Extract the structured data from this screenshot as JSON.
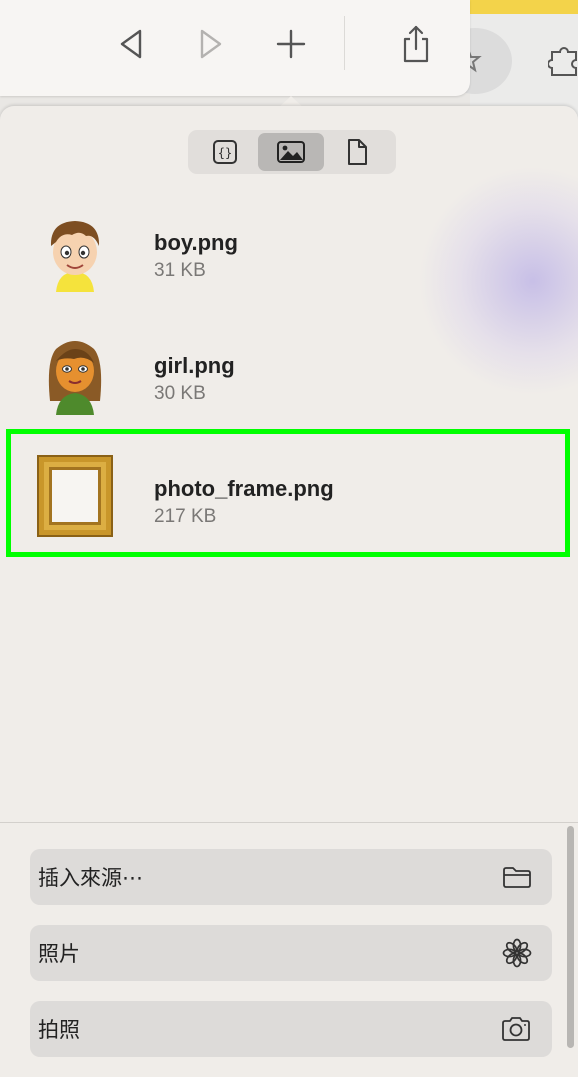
{
  "toolbar": {
    "back_icon": "back-triangle-icon",
    "forward_icon": "forward-triangle-icon",
    "new_tab_icon": "plus-icon",
    "share_icon": "share-icon"
  },
  "segments": [
    {
      "name": "json-icon",
      "active": false
    },
    {
      "name": "image-icon",
      "active": true
    },
    {
      "name": "document-icon",
      "active": false
    }
  ],
  "files": [
    {
      "name": "boy.png",
      "size": "31 KB"
    },
    {
      "name": "girl.png",
      "size": "30 KB"
    },
    {
      "name": "photo_frame.png",
      "size": "217 KB"
    }
  ],
  "actions": [
    {
      "label": "插入來源⋯",
      "icon": "folder-icon"
    },
    {
      "label": "照片",
      "icon": "flower-icon"
    },
    {
      "label": "拍照",
      "icon": "camera-icon"
    }
  ],
  "colors": {
    "highlight": "#00ff00",
    "accent_yellow": "#f3d34a"
  }
}
